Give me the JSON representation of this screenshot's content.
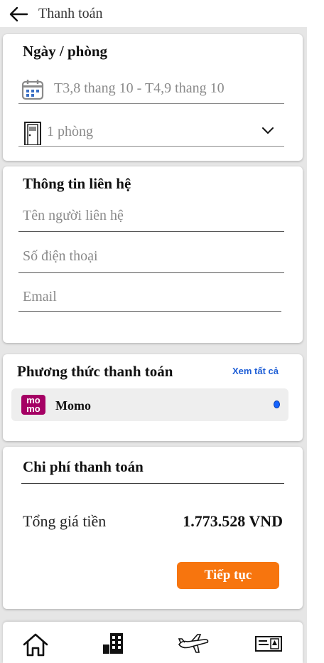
{
  "header": {
    "title": "Thanh toán",
    "back_icon": "arrow-left-icon"
  },
  "booking": {
    "title": "Ngày / phòng",
    "date_range": "T3,8 thang 10 - T4,9 thang 10",
    "rooms": "1 phòng",
    "calendar_icon": "calendar-icon",
    "door_icon": "door-icon"
  },
  "contact": {
    "title": "Thông tin liên hệ",
    "name_placeholder": "Tên người liên hệ",
    "phone_placeholder": "Số điện thoại",
    "email_placeholder": "Email"
  },
  "payment": {
    "title": "Phương thức thanh toán",
    "see_all": "Xem tất cả",
    "method": {
      "name": "Momo",
      "logo_text_1": "mo",
      "logo_text_2": "mo",
      "selected": true
    }
  },
  "cost": {
    "title": "Chi phí thanh toán",
    "total_label": "Tổng giá tiền",
    "total_value": "1.773.528 VND",
    "continue_label": "Tiếp tục"
  },
  "nav": [
    "home-icon",
    "hotel-icon",
    "flight-icon",
    "ticket-icon"
  ],
  "colors": {
    "accent": "#f7750e",
    "link": "#1f5fd6",
    "momo": "#a50064",
    "panel_bg": "#e6e6e6"
  }
}
